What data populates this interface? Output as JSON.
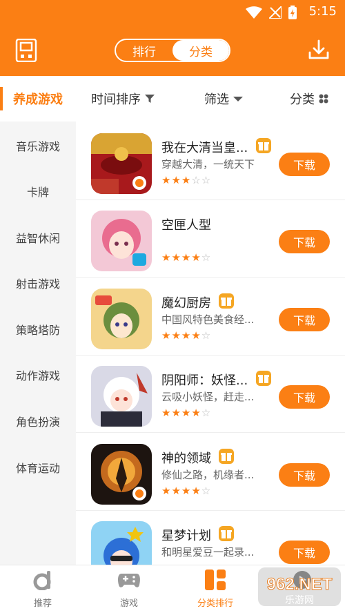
{
  "status_bar": {
    "time": "5:15"
  },
  "header": {
    "tabs": [
      {
        "label": "排行"
      },
      {
        "label": "分类"
      }
    ],
    "active_tab": "分类"
  },
  "sidebar": {
    "items": [
      {
        "label": "养成游戏"
      },
      {
        "label": "音乐游戏"
      },
      {
        "label": "卡牌"
      },
      {
        "label": "益智休闲"
      },
      {
        "label": "射击游戏"
      },
      {
        "label": "策略塔防"
      },
      {
        "label": "动作游戏"
      },
      {
        "label": "角色扮演"
      },
      {
        "label": "体育运动"
      }
    ],
    "active_index": 0
  },
  "filters": {
    "time_sort": "时间排序",
    "filter": "筛选",
    "category": "分类"
  },
  "apps": [
    {
      "title": "我在大清当皇...",
      "subtitle": "穿越大清，一统天下",
      "rating": 3,
      "gift": true,
      "download": "下载",
      "icon": "emperor-game-icon"
    },
    {
      "title": "空匣人型",
      "subtitle": "",
      "rating": 4,
      "gift": false,
      "download": "下载",
      "icon": "anime-girl-game-icon"
    },
    {
      "title": "魔幻厨房",
      "subtitle": "中国风特色美食经...",
      "rating": 4,
      "gift": true,
      "download": "下载",
      "icon": "kitchen-game-icon"
    },
    {
      "title": "阴阳师：妖怪...",
      "subtitle": "云吸小妖怪，赶走...",
      "rating": 4,
      "gift": true,
      "download": "下载",
      "icon": "onmyoji-game-icon"
    },
    {
      "title": "神的领域",
      "subtitle": "修仙之路，机缘者...",
      "rating": 4,
      "gift": true,
      "download": "下载",
      "icon": "realm-game-icon"
    },
    {
      "title": "星梦计划",
      "subtitle": "和明星爱豆一起录...",
      "rating": 4,
      "gift": true,
      "download": "下载",
      "icon": "star-dream-game-icon"
    }
  ],
  "bottom_nav": {
    "items": [
      {
        "label": "推荐",
        "icon": "recommend-icon"
      },
      {
        "label": "游戏",
        "icon": "gamepad-icon"
      },
      {
        "label": "分类排行",
        "icon": "category-rank-icon"
      },
      {
        "label": "",
        "icon": "video-icon"
      }
    ],
    "active_index": 2
  },
  "watermark": {
    "text": "962.NET",
    "subtext": "乐游网"
  },
  "colors": {
    "accent": "#fb7f14",
    "gift": "#f5a623",
    "sidebar_bg": "#f5f5f5"
  }
}
